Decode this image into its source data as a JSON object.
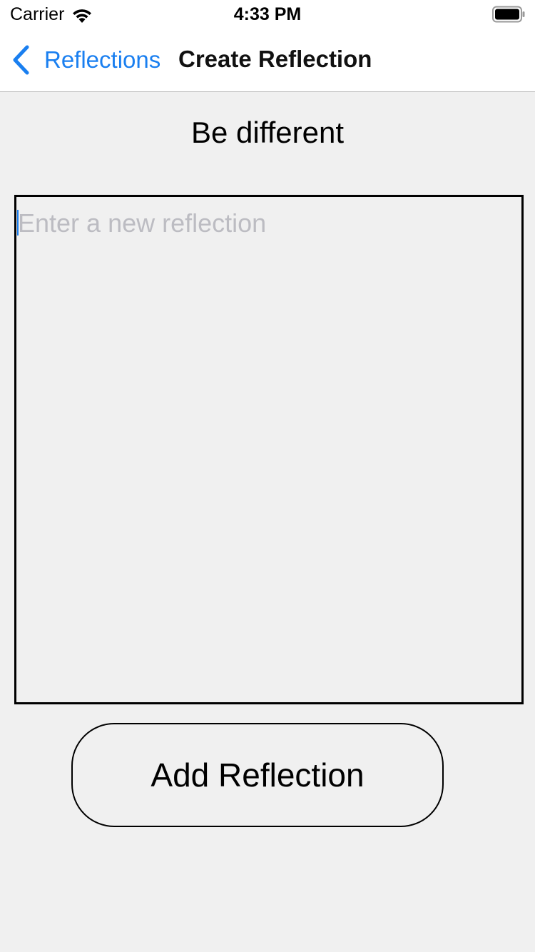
{
  "status_bar": {
    "carrier": "Carrier",
    "time": "4:33 PM",
    "wifi_icon": "wifi-icon",
    "battery_icon": "battery-icon"
  },
  "nav": {
    "back_label": "Reflections",
    "back_icon": "chevron-left-icon",
    "title": "Create Reflection",
    "accent_color": "#1a7ff0"
  },
  "main": {
    "heading": "Be different",
    "reflection_input": {
      "value": "",
      "placeholder": "Enter a new reflection"
    },
    "add_button_label": "Add Reflection"
  },
  "colors": {
    "background": "#f0f0f0",
    "bar_background": "#ffffff",
    "placeholder": "#bcbcc2"
  }
}
